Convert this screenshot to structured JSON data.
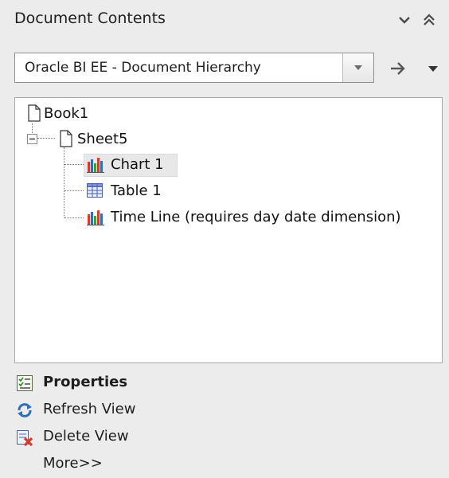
{
  "panel": {
    "title": "Document Contents"
  },
  "view_selector": {
    "value": "Oracle BI EE - Document Hierarchy"
  },
  "tree": {
    "items": [
      {
        "label": "Book1",
        "icon": "document-icon"
      },
      {
        "label": "Sheet5",
        "icon": "document-icon",
        "expanded": true
      },
      {
        "label": "Chart 1",
        "icon": "bar-chart-icon",
        "selected": true
      },
      {
        "label": "Table 1",
        "icon": "table-icon"
      },
      {
        "label": "Time Line (requires day date dimension)",
        "icon": "bar-chart-icon"
      }
    ]
  },
  "actions": {
    "properties": "Properties",
    "refresh": "Refresh View",
    "delete": "Delete View",
    "more": "More>>"
  },
  "colors": {
    "panel_bg": "#ececec",
    "tree_bg": "#ffffff",
    "selection": "#e8e8e8",
    "accent_blue": "#2f6fb6",
    "accent_red": "#d43c2c"
  }
}
